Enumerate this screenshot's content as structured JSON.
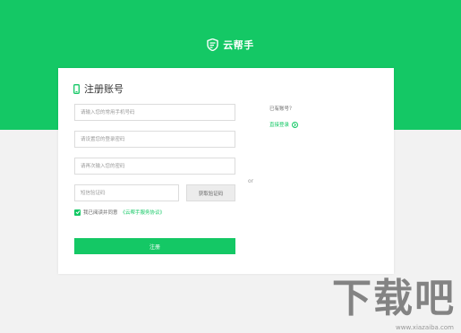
{
  "brand": {
    "name": "云帮手",
    "color": "#ffffff",
    "icon": "shield-logo-icon"
  },
  "colors": {
    "accent": "#14c865",
    "band": "#14c865",
    "page_bg": "#f2f2f2"
  },
  "register": {
    "title": "注册账号",
    "title_icon": "phone-icon",
    "phone_placeholder": "请输入您的常用手机号码",
    "password_placeholder": "请设置您的登录密码",
    "confirm_placeholder": "请再次输入您的密码",
    "code_placeholder": "短信验证码",
    "get_code_label": "获取验证码",
    "agree_text": "我已阅读并同意",
    "agree_link": "《云帮手服务协议》",
    "submit_label": "注册"
  },
  "side": {
    "or_text": "or",
    "have_account": "已有账号？",
    "login_link": "直接登录"
  },
  "watermark": {
    "title": "下载吧",
    "url": "www.xiazaiba.com"
  }
}
